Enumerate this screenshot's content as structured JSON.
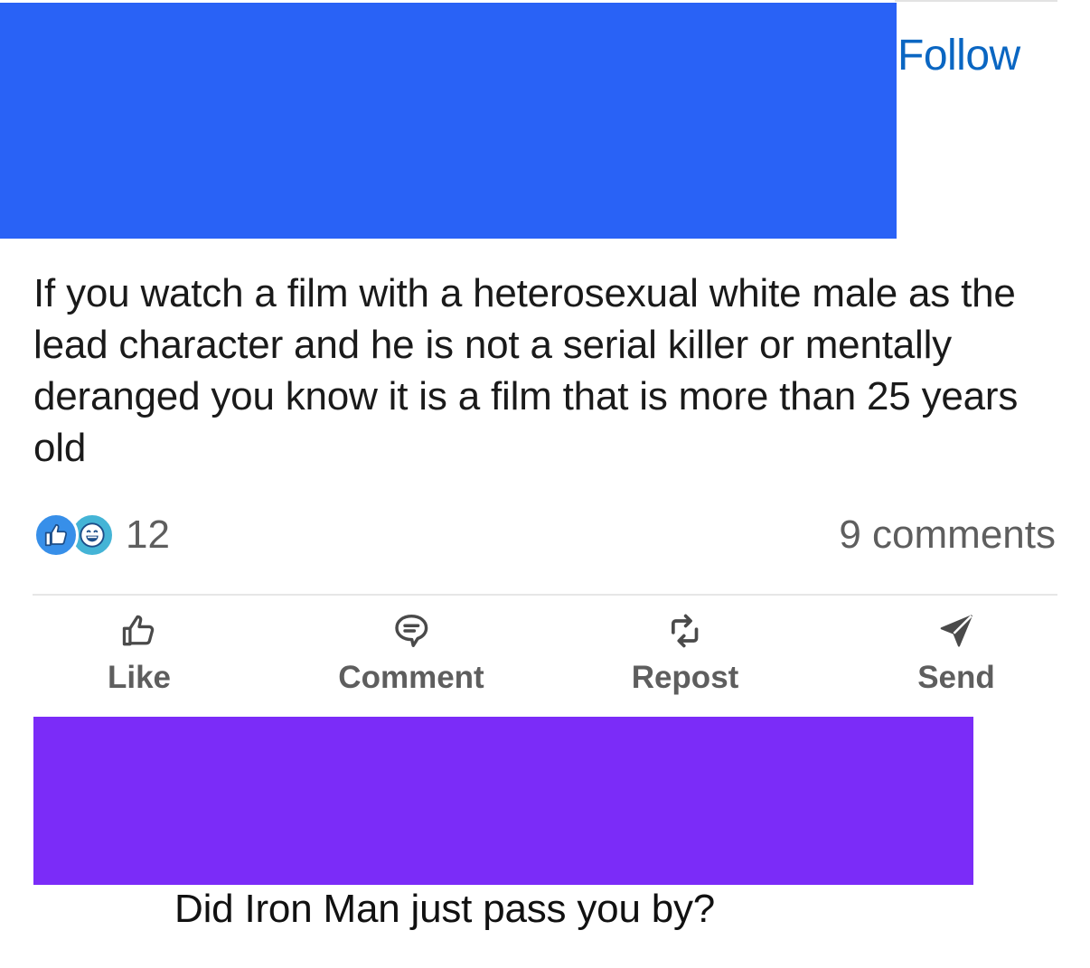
{
  "colors": {
    "header_redaction": "#2962f6",
    "footer_redaction": "#7b2cf8",
    "link_blue": "#0a66c2",
    "muted_text": "#5e5e5e"
  },
  "header": {
    "follow_label": "Follow"
  },
  "post": {
    "text": "If you watch a film with a heterosexual white male as the lead character and he is not a serial killer or mentally deranged you know it is a film that is more than 25 years old"
  },
  "social": {
    "reaction_icons": [
      "like-icon",
      "funny-icon"
    ],
    "reaction_count": "12",
    "comments_label": "9 comments"
  },
  "actions": [
    {
      "label": "Like",
      "icon": "thumbs-up-icon"
    },
    {
      "label": "Comment",
      "icon": "comment-icon"
    },
    {
      "label": "Repost",
      "icon": "repost-icon"
    },
    {
      "label": "Send",
      "icon": "send-icon"
    }
  ],
  "caption": "Did Iron Man just pass you by?"
}
